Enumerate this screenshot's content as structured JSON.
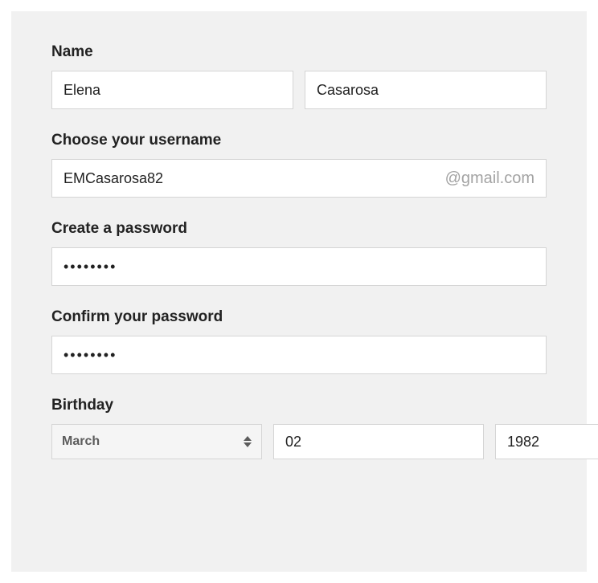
{
  "name": {
    "label": "Name",
    "first": "Elena",
    "last": "Casarosa"
  },
  "username": {
    "label": "Choose your username",
    "value": "EMCasarosa82",
    "suffix": "@gmail.com"
  },
  "password": {
    "label": "Create a password",
    "value": "••••••••"
  },
  "confirm": {
    "label": "Confirm your password",
    "value": "••••••••"
  },
  "birthday": {
    "label": "Birthday",
    "month": "March",
    "day": "02",
    "year": "1982"
  }
}
